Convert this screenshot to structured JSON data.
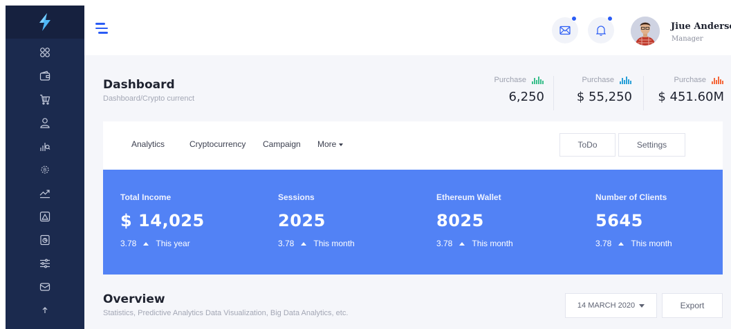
{
  "header": {
    "user_name": "Jiue Anderson",
    "user_role": "Manager"
  },
  "sidebar": {
    "items": [
      {
        "icon": "apps-icon"
      },
      {
        "icon": "wallet-icon"
      },
      {
        "icon": "cart-icon"
      },
      {
        "icon": "user-icon"
      },
      {
        "icon": "bar-chart-icon"
      },
      {
        "icon": "bitcoin-icon"
      },
      {
        "icon": "trend-icon"
      },
      {
        "icon": "image-icon"
      },
      {
        "icon": "file-icon"
      },
      {
        "icon": "sliders-icon"
      },
      {
        "icon": "mail-icon"
      }
    ]
  },
  "page": {
    "title": "Dashboard",
    "breadcrumb": "Dashboard/Crypto currenct"
  },
  "stats": [
    {
      "label": "Purchase",
      "value": "6,250",
      "color": "#3bbf8c"
    },
    {
      "label": "Purchase",
      "value": "$ 55,250",
      "color": "#2aa0d8"
    },
    {
      "label": "Purchase",
      "value": "$ 451.60M",
      "color": "#f4683c"
    }
  ],
  "tabs": {
    "items": [
      "Analytics",
      "Cryptocurrency",
      "Campaign",
      "More"
    ],
    "todo_label": "ToDo",
    "settings_label": "Settings"
  },
  "kpis": [
    {
      "label": "Total Income",
      "value": "$ 14,025",
      "change": "3.78",
      "period": "This year"
    },
    {
      "label": "Sessions",
      "value": "2025",
      "change": "3.78",
      "period": "This month"
    },
    {
      "label": "Ethereum Wallet",
      "value": "8025",
      "change": "3.78",
      "period": "This month"
    },
    {
      "label": "Number of Clients",
      "value": "5645",
      "change": "3.78",
      "period": "This month"
    }
  ],
  "overview": {
    "title": "Overview",
    "subtitle": "Statistics, Predictive Analytics Data Visualization, Big Data Analytics, etc.",
    "date": "14 MARCH 2020",
    "export_label": "Export"
  },
  "colors": {
    "sidebar_bg": "#1b2a4e",
    "accent_blue": "#2a5cf5",
    "kpi_panel": "#5282f5"
  }
}
